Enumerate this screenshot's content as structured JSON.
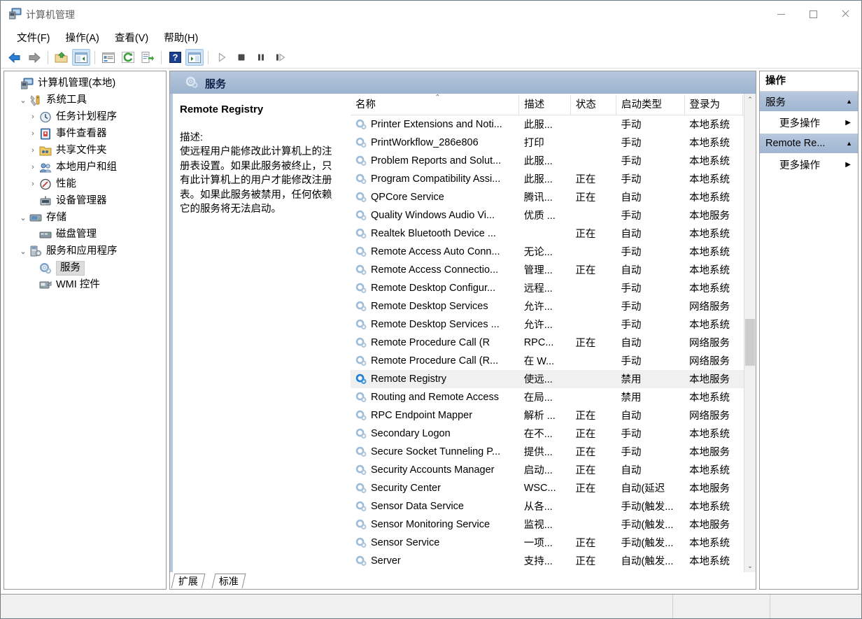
{
  "window": {
    "title": "计算机管理",
    "icon": "computer-management-icon",
    "minimize_label": "",
    "maximize_label": "",
    "close_label": ""
  },
  "menu": [
    {
      "label": "文件(F)",
      "name": "menu-file"
    },
    {
      "label": "操作(A)",
      "name": "menu-action"
    },
    {
      "label": "查看(V)",
      "name": "menu-view"
    },
    {
      "label": "帮助(H)",
      "name": "menu-help"
    }
  ],
  "toolbar": [
    {
      "name": "back-icon",
      "enabled": true
    },
    {
      "name": "forward-icon",
      "enabled": true
    },
    {
      "name": "up-folder-icon",
      "enabled": true
    },
    {
      "name": "show-tree-icon",
      "enabled": true,
      "active": true
    },
    {
      "name": "properties-icon",
      "enabled": true
    },
    {
      "name": "refresh-icon",
      "enabled": true
    },
    {
      "name": "export-list-icon",
      "enabled": true
    },
    {
      "name": "help-icon",
      "enabled": true
    },
    {
      "name": "show-action-pane-icon",
      "enabled": true,
      "active": true
    },
    {
      "name": "start-service-icon",
      "enabled": false
    },
    {
      "name": "stop-service-icon",
      "enabled": false
    },
    {
      "name": "pause-service-icon",
      "enabled": false
    },
    {
      "name": "restart-service-icon",
      "enabled": false
    }
  ],
  "tree": [
    {
      "label": "计算机管理(本地)",
      "indent": 0,
      "twisty": "",
      "icon": "computer-icon",
      "selected": false
    },
    {
      "label": "系统工具",
      "indent": 1,
      "twisty": "⌄",
      "icon": "system-tools-icon",
      "selected": false
    },
    {
      "label": "任务计划程序",
      "indent": 2,
      "twisty": "›",
      "icon": "task-scheduler-icon",
      "selected": false
    },
    {
      "label": "事件查看器",
      "indent": 2,
      "twisty": "›",
      "icon": "event-viewer-icon",
      "selected": false
    },
    {
      "label": "共享文件夹",
      "indent": 2,
      "twisty": "›",
      "icon": "shared-folders-icon",
      "selected": false
    },
    {
      "label": "本地用户和组",
      "indent": 2,
      "twisty": "›",
      "icon": "local-users-groups-icon",
      "selected": false
    },
    {
      "label": "性能",
      "indent": 2,
      "twisty": "›",
      "icon": "performance-icon",
      "selected": false
    },
    {
      "label": "设备管理器",
      "indent": 2,
      "twisty": "",
      "icon": "device-manager-icon",
      "selected": false
    },
    {
      "label": "存储",
      "indent": 1,
      "twisty": "⌄",
      "icon": "storage-icon",
      "selected": false
    },
    {
      "label": "磁盘管理",
      "indent": 2,
      "twisty": "",
      "icon": "disk-management-icon",
      "selected": false
    },
    {
      "label": "服务和应用程序",
      "indent": 1,
      "twisty": "⌄",
      "icon": "services-apps-icon",
      "selected": false
    },
    {
      "label": "服务",
      "indent": 2,
      "twisty": "",
      "icon": "services-icon",
      "selected": true
    },
    {
      "label": "WMI 控件",
      "indent": 2,
      "twisty": "",
      "icon": "wmi-control-icon",
      "selected": false
    }
  ],
  "pane_header": {
    "title": "服务",
    "icon": "services-gear-icon"
  },
  "detail": {
    "service_name": "Remote Registry",
    "description_label": "描述:",
    "description_text": "使远程用户能修改此计算机上的注册表设置。如果此服务被终止，只有此计算机上的用户才能修改注册表。如果此服务被禁用，任何依赖它的服务将无法启动。"
  },
  "list": {
    "columns": [
      {
        "label": "名称",
        "name": "column-name",
        "sorted": "asc"
      },
      {
        "label": "描述",
        "name": "column-description"
      },
      {
        "label": "状态",
        "name": "column-status"
      },
      {
        "label": "启动类型",
        "name": "column-startup-type"
      },
      {
        "label": "登录为",
        "name": "column-log-on-as"
      }
    ],
    "rows": [
      {
        "name": "Printer Extensions and Noti...",
        "description": "此服...",
        "status": "",
        "startup": "手动",
        "logon": "本地系统",
        "selected": false
      },
      {
        "name": "PrintWorkflow_286e806",
        "description": "打印",
        "status": "",
        "startup": "手动",
        "logon": "本地系统",
        "selected": false
      },
      {
        "name": "Problem Reports and Solut...",
        "description": "此服...",
        "status": "",
        "startup": "手动",
        "logon": "本地系统",
        "selected": false
      },
      {
        "name": "Program Compatibility Assi...",
        "description": "此服...",
        "status": "正在",
        "startup": "手动",
        "logon": "本地系统",
        "selected": false
      },
      {
        "name": "QPCore Service",
        "description": "腾讯...",
        "status": "正在",
        "startup": "自动",
        "logon": "本地系统",
        "selected": false
      },
      {
        "name": "Quality Windows Audio Vi...",
        "description": "优质 ...",
        "status": "",
        "startup": "手动",
        "logon": "本地服务",
        "selected": false
      },
      {
        "name": "Realtek Bluetooth Device ...",
        "description": "",
        "status": "正在",
        "startup": "自动",
        "logon": "本地系统",
        "selected": false
      },
      {
        "name": "Remote Access Auto Conn...",
        "description": "无论...",
        "status": "",
        "startup": "手动",
        "logon": "本地系统",
        "selected": false
      },
      {
        "name": "Remote Access Connectio...",
        "description": "管理...",
        "status": "正在",
        "startup": "自动",
        "logon": "本地系统",
        "selected": false
      },
      {
        "name": "Remote Desktop Configur...",
        "description": "远程...",
        "status": "",
        "startup": "手动",
        "logon": "本地系统",
        "selected": false
      },
      {
        "name": "Remote Desktop Services",
        "description": "允许...",
        "status": "",
        "startup": "手动",
        "logon": "网络服务",
        "selected": false
      },
      {
        "name": "Remote Desktop Services ...",
        "description": "允许...",
        "status": "",
        "startup": "手动",
        "logon": "本地系统",
        "selected": false
      },
      {
        "name": "Remote Procedure Call (R",
        "description": "RPC...",
        "status": "正在",
        "startup": "自动",
        "logon": "网络服务",
        "selected": false
      },
      {
        "name": "Remote Procedure Call (R...",
        "description": "在 W...",
        "status": "",
        "startup": "手动",
        "logon": "网络服务",
        "selected": false
      },
      {
        "name": "Remote Registry",
        "description": "使远...",
        "status": "",
        "startup": "禁用",
        "logon": "本地服务",
        "selected": true
      },
      {
        "name": "Routing and Remote Access",
        "description": "在局...",
        "status": "",
        "startup": "禁用",
        "logon": "本地系统",
        "selected": false
      },
      {
        "name": "RPC Endpoint Mapper",
        "description": "解析 ...",
        "status": "正在",
        "startup": "自动",
        "logon": "网络服务",
        "selected": false
      },
      {
        "name": "Secondary Logon",
        "description": "在不...",
        "status": "正在",
        "startup": "手动",
        "logon": "本地系统",
        "selected": false
      },
      {
        "name": "Secure Socket Tunneling P...",
        "description": "提供...",
        "status": "正在",
        "startup": "手动",
        "logon": "本地服务",
        "selected": false
      },
      {
        "name": "Security Accounts Manager",
        "description": "启动...",
        "status": "正在",
        "startup": "自动",
        "logon": "本地系统",
        "selected": false
      },
      {
        "name": "Security Center",
        "description": "WSC...",
        "status": "正在",
        "startup": "自动(延迟",
        "logon": "本地服务",
        "selected": false
      },
      {
        "name": "Sensor Data Service",
        "description": "从各...",
        "status": "",
        "startup": "手动(触发...",
        "logon": "本地系统",
        "selected": false
      },
      {
        "name": "Sensor Monitoring Service",
        "description": "监视...",
        "status": "",
        "startup": "手动(触发...",
        "logon": "本地服务",
        "selected": false
      },
      {
        "name": "Sensor Service",
        "description": "一项...",
        "status": "正在",
        "startup": "手动(触发...",
        "logon": "本地系统",
        "selected": false
      },
      {
        "name": "Server",
        "description": "支持...",
        "status": "正在",
        "startup": "自动(触发...",
        "logon": "本地系统",
        "selected": false
      }
    ]
  },
  "view_tabs": [
    {
      "label": "扩展",
      "name": "tab-extended",
      "active": false
    },
    {
      "label": "标准",
      "name": "tab-standard",
      "active": true
    }
  ],
  "actions": {
    "header": "操作",
    "sections": [
      {
        "title": "服务",
        "name": "actions-section-services",
        "items": [
          {
            "label": "更多操作",
            "name": "more-actions-services"
          }
        ]
      },
      {
        "title": "Remote Re...",
        "name": "actions-section-remote-registry",
        "items": [
          {
            "label": "更多操作",
            "name": "more-actions-remote-registry"
          }
        ]
      }
    ]
  },
  "scrollbar": {
    "up_arrow": "⌃",
    "down_arrow": "⌄"
  }
}
